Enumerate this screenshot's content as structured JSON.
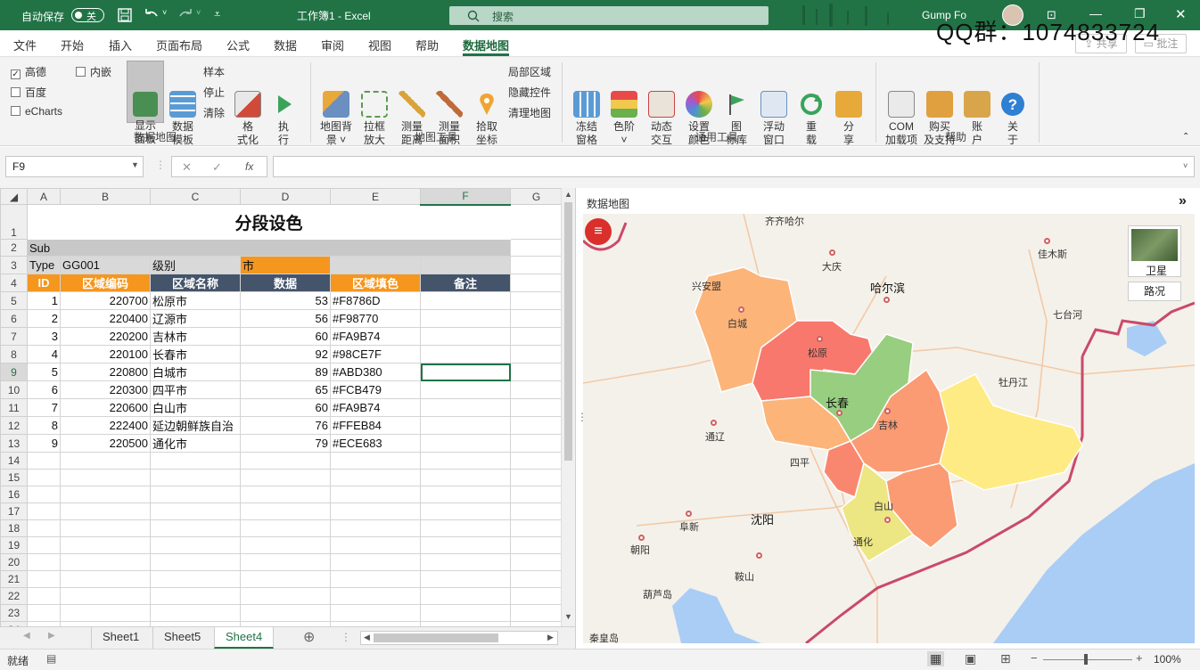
{
  "titlebar": {
    "autosave_label": "自动保存",
    "autosave_state": "关",
    "doc_title": "工作簿1  -  Excel",
    "search_placeholder": "搜索",
    "user_name": "Gump Fo",
    "watermark": "QQ群：1074833724"
  },
  "ribbon_tabs": [
    "文件",
    "开始",
    "插入",
    "页面布局",
    "公式",
    "数据",
    "审阅",
    "视图",
    "帮助",
    "数据地图"
  ],
  "ribbon_right": {
    "share": "共享",
    "comment": "批注"
  },
  "ribbon": {
    "checks": [
      {
        "label": "高德",
        "checked": true
      },
      {
        "label": "百度",
        "checked": false
      },
      {
        "label": "eCharts",
        "checked": false
      },
      {
        "label": "内嵌",
        "checked": false
      }
    ],
    "g1_buttons": [
      {
        "label": "显示\n面板"
      },
      {
        "label": "数据\n模板"
      }
    ],
    "g1_small": [
      "样本",
      "停止",
      "清除"
    ],
    "g1_buttons2": [
      {
        "label": "格\n式化"
      },
      {
        "label": "执\n行"
      }
    ],
    "g1_name": "数据地图",
    "g2_buttons": [
      {
        "label": "地图背\n景 ˅"
      },
      {
        "label": "拉框\n放大"
      },
      {
        "label": "测量\n距离"
      },
      {
        "label": "测量\n面积"
      },
      {
        "label": "拾取\n坐标"
      }
    ],
    "g2_small": [
      "局部区域",
      "隐藏控件",
      "清理地图"
    ],
    "g2_name": "地图工具",
    "g3_buttons": [
      {
        "label": "冻结\n窗格"
      },
      {
        "label": "色阶\n˅"
      },
      {
        "label": "动态\n交互"
      },
      {
        "label": "设置\n颜色"
      },
      {
        "label": "图\n标库"
      },
      {
        "label": "浮动\n窗口"
      },
      {
        "label": "重\n载"
      },
      {
        "label": "分\n享"
      }
    ],
    "g3_name": "通用工具",
    "g4_buttons": [
      {
        "label": "COM\n加载项"
      },
      {
        "label": "购买\n及支持"
      },
      {
        "label": "账\n户"
      },
      {
        "label": "关\n于"
      }
    ],
    "g4_name": "帮助"
  },
  "formula": {
    "namebox": "F9",
    "fx": "fx",
    "content": ""
  },
  "sheet": {
    "col_headers": [
      "A",
      "B",
      "C",
      "D",
      "E",
      "F",
      "G"
    ],
    "title": "分段设色",
    "row2": "Sub",
    "row3": {
      "type": "Type",
      "code": "GG001",
      "level": "级别",
      "level_value": "市"
    },
    "headers": [
      "ID",
      "区域编码",
      "区域名称",
      "数据",
      "区域填色",
      "备注"
    ],
    "rows": [
      {
        "id": "1",
        "code": "220700",
        "name": "松原市",
        "value": "53",
        "color": "#F8786D"
      },
      {
        "id": "2",
        "code": "220400",
        "name": "辽源市",
        "value": "56",
        "color": "#F98770"
      },
      {
        "id": "3",
        "code": "220200",
        "name": "吉林市",
        "value": "60",
        "color": "#FA9B74"
      },
      {
        "id": "4",
        "code": "220100",
        "name": "长春市",
        "value": "92",
        "color": "#98CE7F"
      },
      {
        "id": "5",
        "code": "220800",
        "name": "白城市",
        "value": "89",
        "color": "#ABD380"
      },
      {
        "id": "6",
        "code": "220300",
        "name": "四平市",
        "value": "65",
        "color": "#FCB479"
      },
      {
        "id": "7",
        "code": "220600",
        "name": "白山市",
        "value": "60",
        "color": "#FA9B74"
      },
      {
        "id": "8",
        "code": "222400",
        "name": "延边朝鲜族自治",
        "value": "76",
        "color": "#FFEB84"
      },
      {
        "id": "9",
        "code": "220500",
        "name": "通化市",
        "value": "79",
        "color": "#ECE683"
      }
    ],
    "row_numbers": [
      "1",
      "2",
      "3",
      "4",
      "5",
      "6",
      "7",
      "8",
      "9",
      "10",
      "11",
      "12",
      "13",
      "14",
      "15",
      "16",
      "17",
      "18",
      "19",
      "20",
      "21",
      "22",
      "23",
      "24"
    ]
  },
  "sheet_tabs": [
    "Sheet1",
    "Sheet5",
    "Sheet4"
  ],
  "active_tab": "Sheet4",
  "status": {
    "ready": "就绪",
    "zoom": "100%"
  },
  "map": {
    "pane_title": "数据地图",
    "layer_satellite": "卫星",
    "layer_traffic": "路况",
    "cities": [
      "齐齐哈尔",
      "大庆",
      "佳木斯",
      "兴安盟",
      "哈尔滨",
      "白城",
      "七台河",
      "松原",
      "长春",
      "牡丹江",
      "吉林",
      "通辽",
      "四平",
      "白山",
      "沈阳",
      "阜新",
      "通化",
      "朝阳",
      "鞍山",
      "葫芦岛",
      "秦皇岛"
    ]
  }
}
